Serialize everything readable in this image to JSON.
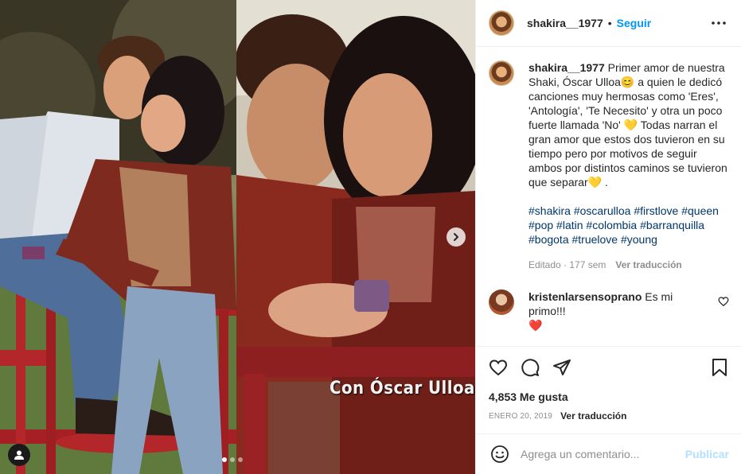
{
  "post": {
    "username": "shakira__1977",
    "follow_label": "Seguir",
    "separator": "•",
    "photo_caption": "Con Óscar Ulloa",
    "carousel": {
      "total_slides": 3,
      "active_slide": 1
    }
  },
  "caption": {
    "username": "shakira__1977",
    "text": "Primer amor de nuestra Shaki, Óscar Ulloa😊 a quien le dedicó canciones muy hermosas como 'Eres', 'Antología', 'Te Necesito' y otra un poco fuerte llamada 'No' 💛 Todas narran el gran amor que estos dos tuvieron en su tiempo pero por motivos de seguir ambos por distintos caminos se tuvieron que separar💛 .",
    "hashtags": [
      "#shakira",
      "#oscarulloa",
      "#firstlove",
      "#queen",
      "#pop",
      "#latin",
      "#colombia",
      "#barranquilla",
      "#bogota",
      "#truelove",
      "#young"
    ],
    "edited": "Editado · 177 sem",
    "translate": "Ver traducción"
  },
  "comment": {
    "username": "kristenlarsensoprano",
    "text": "Es mi primo!!!",
    "emoji": "❤️"
  },
  "likes": "4,853 Me gusta",
  "date": "ENERO 20, 2019",
  "date_translate": "Ver traducción",
  "add_comment": {
    "placeholder": "Agrega un comentario...",
    "post_label": "Publicar"
  },
  "colors": {
    "accent": "#0095f6",
    "post_disabled": "#b2dffc",
    "text": "#262626",
    "muted": "#8e8e8e",
    "like_heart": "#ed4956"
  }
}
